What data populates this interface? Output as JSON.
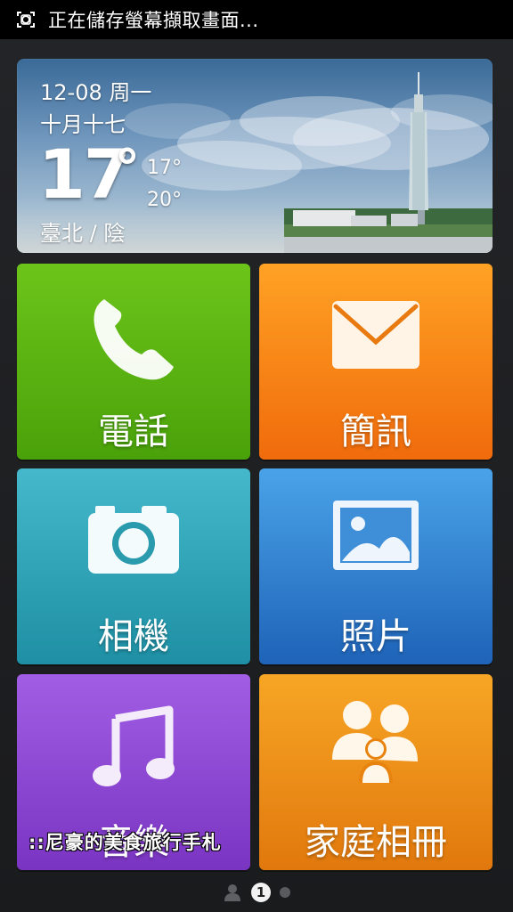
{
  "status_bar": {
    "notification_text": "正在儲存螢幕擷取畫面...",
    "icon": "screenshot-icon"
  },
  "weather": {
    "date": "12-08 周一",
    "lunar_date": "十月十七",
    "current_temp": "17",
    "degree_symbol": "°",
    "low_temp": "17°",
    "high_temp": "20°",
    "location": "臺北 / 陰"
  },
  "tiles": [
    {
      "label": "電話",
      "icon": "phone-icon",
      "color": "#5cb512"
    },
    {
      "label": "簡訊",
      "icon": "envelope-icon",
      "color": "#f78a18"
    },
    {
      "label": "相機",
      "icon": "camera-icon",
      "color": "#33a6b8"
    },
    {
      "label": "照片",
      "icon": "picture-icon",
      "color": "#3584d4"
    },
    {
      "label": "音樂",
      "icon": "music-note-icon",
      "color": "#8e49d5"
    },
    {
      "label": "家庭相冊",
      "icon": "family-icon",
      "color": "#ee8f18"
    }
  ],
  "watermark": "::尼豪的美食旅行手札",
  "pager": {
    "active_page": "1",
    "home_icon": "person-icon"
  }
}
